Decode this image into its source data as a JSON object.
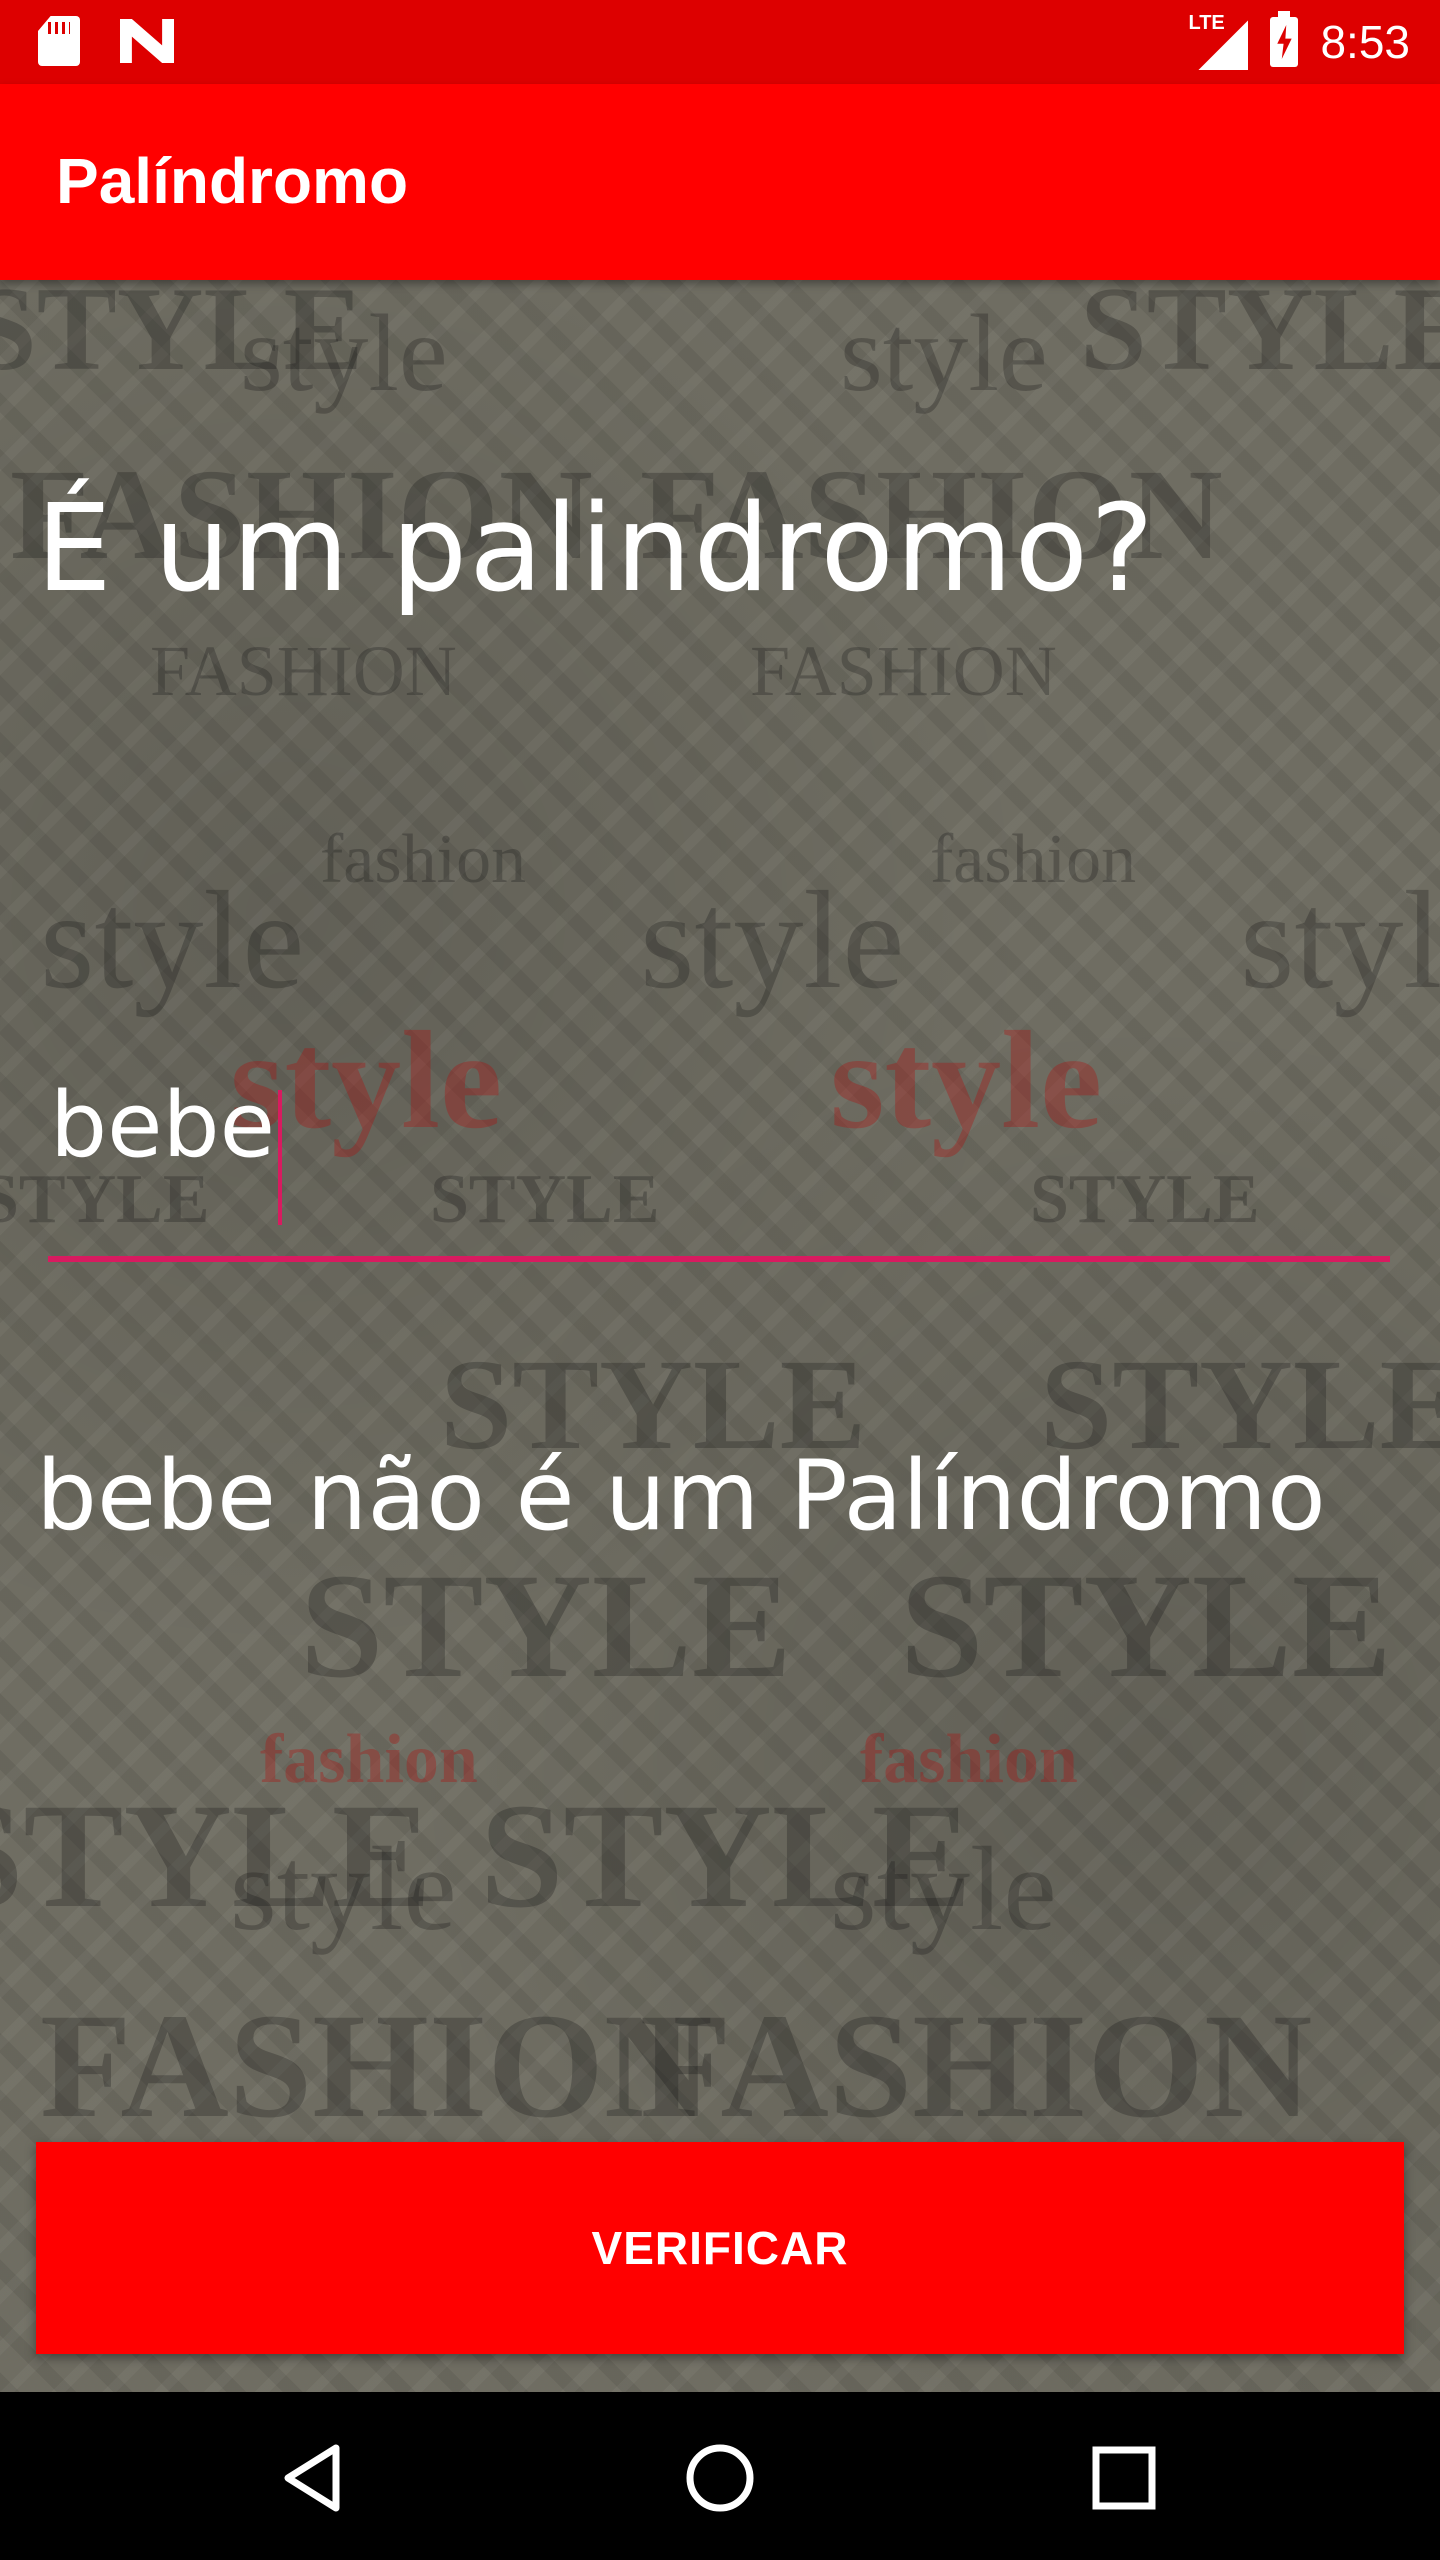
{
  "status_bar": {
    "time": "8:53",
    "network_label": "LTE",
    "icons": [
      "sd-card-icon",
      "n-notification-icon",
      "lte-signal-icon",
      "battery-charging-icon"
    ]
  },
  "app_bar": {
    "title": "Palíndromo"
  },
  "main": {
    "question": "É um palindromo?",
    "input_value": "bebe",
    "result_text": "bebe não é um Palíndromo",
    "verify_button_label": "VERIFICAR",
    "background_words": [
      "STYLE",
      "style",
      "FASHION",
      "fashion"
    ]
  },
  "nav_bar": {
    "icons": [
      "back-icon",
      "home-icon",
      "recents-icon"
    ]
  },
  "colors": {
    "status_bar": "#dd0000",
    "app_bar": "#ff0000",
    "accent": "#d81b60",
    "button": "#ff0000",
    "content_background": "#6f6d62"
  }
}
